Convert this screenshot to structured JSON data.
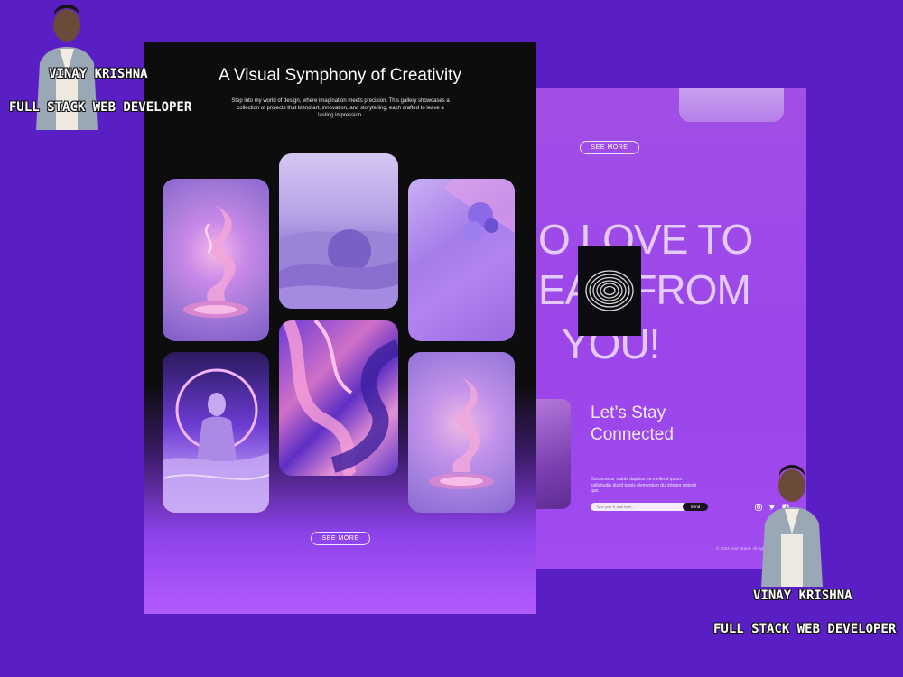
{
  "back_page": {
    "see_more": "SEE MORE",
    "headline_lines": [
      "O LOVE TO",
      "EAR FROM",
      "YOU!"
    ],
    "stay_title": "Let’s Stay Connected",
    "stay_description": "Consectetur mattis dapibus eu eleifend ipsum sollicitudin dis id turpis elementum dui integer potenti que.",
    "email_placeholder": "Type your E-mail here...",
    "send_label": "Send",
    "copyright": "© 2024 Your Brand. All rights reserved."
  },
  "front_page": {
    "title": "A Visual Symphony of Creativity",
    "description": "Step into my world of design, where imagination meets precision. This gallery showcases a collection of projects that blend art, innovation, and storytelling, each crafted to leave a lasting impression.",
    "see_more": "SEE MORE"
  },
  "badges": [
    {
      "name": "VINAY KRISHNA",
      "role": "FULL STACK WEB DEVELOPER"
    },
    {
      "name": "VINAY KRISHNA",
      "role": "FULL STACK WEB DEVELOPER"
    }
  ],
  "icons": {
    "social": [
      "instagram-icon",
      "twitter-icon",
      "facebook-icon"
    ]
  },
  "colors": {
    "background": "#5a1fc4",
    "accent_purple": "#a14fe6",
    "dark_panel": "#0d0d0f"
  }
}
